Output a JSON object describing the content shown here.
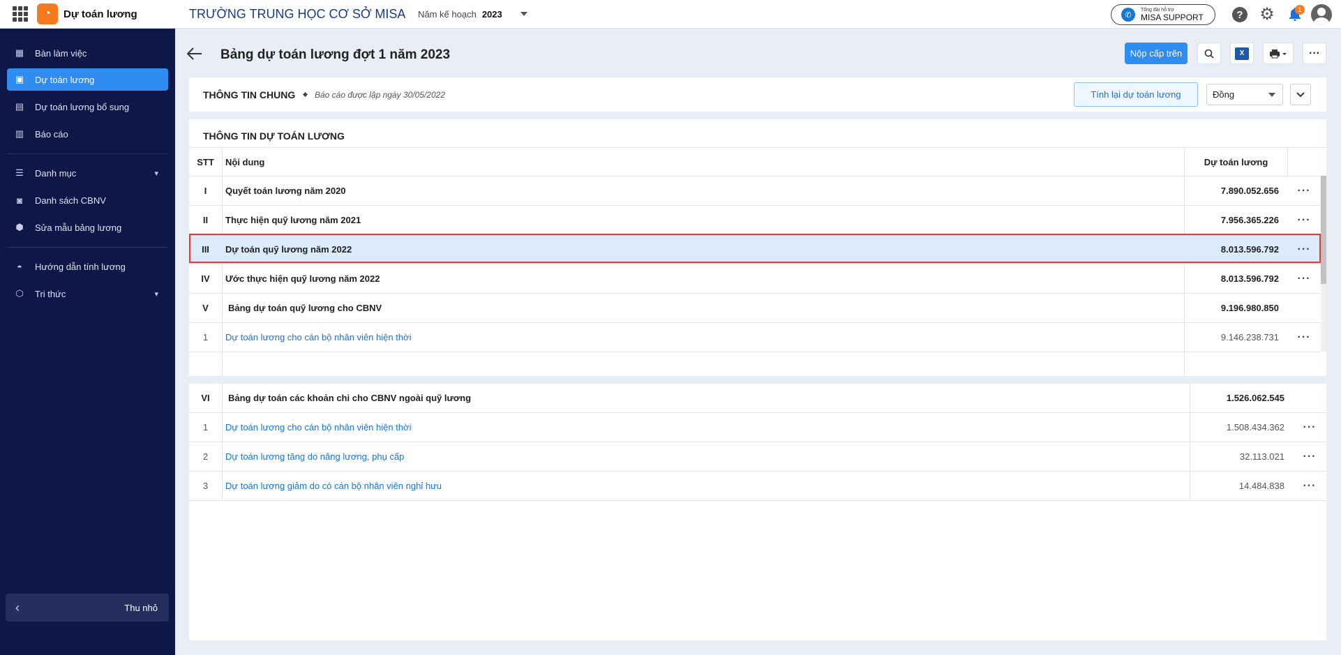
{
  "app": {
    "name": "Dự toán lương",
    "school": "TRƯỜNG TRUNG HỌC CƠ SỞ MISA",
    "plan_year_label": "Năm kế hoạch",
    "plan_year_value": "2023"
  },
  "support": {
    "small": "Tổng đài hỗ trợ",
    "big": "MISA SUPPORT"
  },
  "notifications": {
    "count": "1"
  },
  "sidebar": {
    "items": [
      {
        "label": "Bàn làm việc",
        "icon": "dashboard-icon"
      },
      {
        "label": "Dự toán lương",
        "icon": "calculator-icon",
        "active": true
      },
      {
        "label": "Dự toán lương bổ sung",
        "icon": "supplement-icon"
      },
      {
        "label": "Báo cáo",
        "icon": "chart-icon"
      },
      {
        "label": "Danh mục",
        "icon": "list-icon"
      },
      {
        "label": "Danh sách CBNV",
        "icon": "person-icon"
      },
      {
        "label": "Sửa mẫu bảng lương",
        "icon": "template-icon"
      },
      {
        "label": "Hướng dẫn tính lương",
        "icon": "guide-icon"
      },
      {
        "label": "Tri thức",
        "icon": "cube-icon"
      }
    ],
    "collapse_label": "Thu nhỏ"
  },
  "page": {
    "title": "Bảng dự toán lương đợt 1 năm 2023",
    "submit_label": "Nộp cấp trên"
  },
  "info": {
    "title": "THÔNG TIN CHUNG",
    "subtitle": "Báo cáo được lập ngày 30/05/2022",
    "recalc_label": "Tính lại dự toán lương",
    "unit_value": "Đồng"
  },
  "section1": {
    "title": "THÔNG TIN DỰ TOÁN LƯƠNG",
    "headers": {
      "stt": "STT",
      "content": "Nội dung",
      "value": "Dự toán lương"
    },
    "rows": [
      {
        "stt": "I",
        "content": "Quyết toán lương năm 2020",
        "value": "7.890.052.656"
      },
      {
        "stt": "II",
        "content": "Thực hiện quỹ lương năm 2021",
        "value": "7.956.365.226"
      },
      {
        "stt": "III",
        "content": "Dự toán quỹ lương năm 2022",
        "value": "8.013.596.792"
      },
      {
        "stt": "IV",
        "content": "Ước thực hiện quỹ lương năm 2022",
        "value": "8.013.596.792"
      },
      {
        "stt": "V",
        "content": "Bảng dự toán quỹ lương cho CBNV",
        "value": "9.196.980.850"
      },
      {
        "stt": "1",
        "content": "Dự toán lương cho cán bộ nhân viên hiện thời",
        "value": "9.146.238.731"
      }
    ]
  },
  "section2": {
    "rows": [
      {
        "stt": "VI",
        "content": "Bảng dự toán các khoản chi cho CBNV ngoài quỹ lương",
        "value": "1.526.062.545"
      },
      {
        "stt": "1",
        "content": "Dự toán lương cho cán bộ nhân viên hiện thời",
        "value": "1.508.434.362"
      },
      {
        "stt": "2",
        "content": "Dự toán lương tăng do nâng lương, phụ cấp",
        "value": "32.113.021"
      },
      {
        "stt": "3",
        "content": "Dự toán lương giảm do có cán bộ nhân viên nghỉ hưu",
        "value": "14.484.838"
      }
    ]
  },
  "colors": {
    "sidebar_bg": "#0e1747",
    "accent": "#2f8cf1",
    "brand": "#f47b20",
    "highlight": "#e53935"
  }
}
